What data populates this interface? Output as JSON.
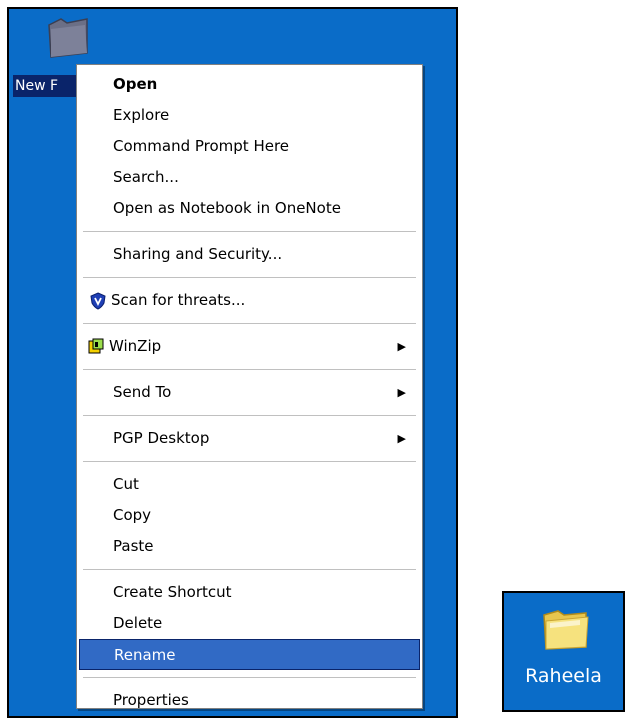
{
  "desktop": {
    "folder_label": "New F",
    "colors": {
      "desktop_bg": "#0a6cc8",
      "selection": "#316ac5"
    }
  },
  "context_menu": {
    "items": [
      {
        "label": "Open",
        "bold": true
      },
      {
        "label": "Explore"
      },
      {
        "label": "Command Prompt Here"
      },
      {
        "label": "Search..."
      },
      {
        "label": "Open as Notebook in OneNote"
      },
      {
        "label": "Sharing and Security..."
      },
      {
        "label": "Scan for threats...",
        "icon": "shield-icon"
      },
      {
        "label": "WinZip",
        "icon": "winzip-icon",
        "submenu": true
      },
      {
        "label": "Send To",
        "submenu": true
      },
      {
        "label": "PGP Desktop",
        "submenu": true
      },
      {
        "label": "Cut"
      },
      {
        "label": "Copy"
      },
      {
        "label": "Paste"
      },
      {
        "label": "Create Shortcut"
      },
      {
        "label": "Delete"
      },
      {
        "label": "Rename",
        "selected": true
      },
      {
        "label": "Properties"
      }
    ],
    "submenu_arrow": "▶"
  },
  "renamed_folder": {
    "label": "Raheela"
  }
}
